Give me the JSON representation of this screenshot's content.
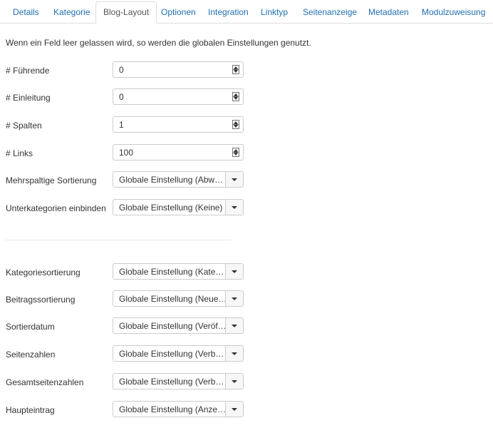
{
  "tabs": [
    {
      "label": "Details"
    },
    {
      "label": "Kategorie"
    },
    {
      "label": "Blog-Layout",
      "active": true
    },
    {
      "label": "Optionen"
    },
    {
      "label": "Integration"
    },
    {
      "label": "Linktyp"
    },
    {
      "label": "Seitenanzeige"
    },
    {
      "label": "Metadaten"
    },
    {
      "label": "Modulzuweisung"
    }
  ],
  "info_text": "Wenn ein Feld leer gelassen wird, so werden die globalen Einstellungen genutzt.",
  "fields": [
    {
      "label": "# Führende",
      "type": "number",
      "value": "0"
    },
    {
      "label": "# Einleitung",
      "type": "number",
      "value": "0"
    },
    {
      "label": "# Spalten",
      "type": "number",
      "value": "1"
    },
    {
      "label": "# Links",
      "type": "number",
      "value": "100"
    },
    {
      "label": "Mehrspaltige Sortierung",
      "type": "select",
      "value": "Globale Einstellung (Abwärts)"
    },
    {
      "label": "Unterkategorien einbinden",
      "type": "select",
      "value": "Globale Einstellung (Keine)"
    },
    {
      "label": "Kategoriesortierung",
      "type": "select",
      "value": "Globale Einstellung (Kategori..."
    },
    {
      "label": "Beitragssortierung",
      "type": "select",
      "value": "Globale Einstellung (Neueste..."
    },
    {
      "label": "Sortierdatum",
      "type": "select",
      "value": "Globale Einstellung (Veröffent..."
    },
    {
      "label": "Seitenzahlen",
      "type": "select",
      "value": "Globale Einstellung (Verbergen)"
    },
    {
      "label": "Gesamtseitenzahlen",
      "type": "select",
      "value": "Globale Einstellung (Verbergen)"
    },
    {
      "label": "Haupteintrag",
      "type": "select",
      "value": "Globale Einstellung (Anzeigen)"
    }
  ],
  "colors": {
    "link": "#1f6fb2",
    "border": "#cccccc",
    "text": "#333333"
  }
}
